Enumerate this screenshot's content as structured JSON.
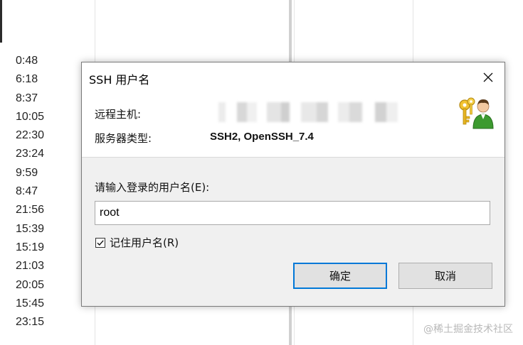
{
  "background": {
    "times": [
      "0:48",
      "6:18",
      "8:37",
      "10:05",
      "22:30",
      "23:24",
      "9:59",
      "8:47",
      "21:56",
      "15:39",
      "15:19",
      "21:03",
      "20:05",
      "15:45",
      "23:15"
    ]
  },
  "dialog": {
    "title": "SSH 用户名",
    "close_icon": "close-icon",
    "host_label": "远程主机:",
    "host_value": "",
    "server_type_label": "服务器类型:",
    "server_type_value": "SSH2, OpenSSH_7.4",
    "keys_icon": "keys-user-icon",
    "username_prompt": "请输入登录的用户名(E):",
    "username_value": "root",
    "remember_label": "记住用户名(R)",
    "remember_checked": true,
    "ok_label": "确定",
    "cancel_label": "取消",
    "accent": "#0078d7"
  },
  "watermark": "@稀土掘金技术社区"
}
